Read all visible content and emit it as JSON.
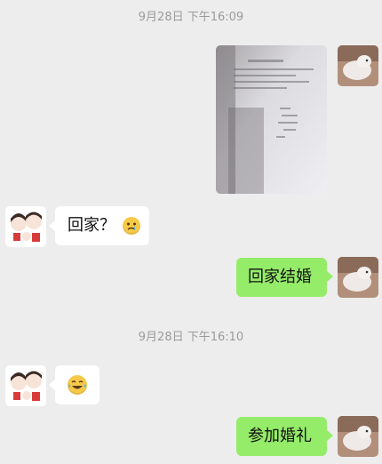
{
  "timestamps": [
    "9月28日 下午16:09",
    "9月28日 下午16:10"
  ],
  "messages": [
    {
      "side": "right",
      "type": "image",
      "image": "document-photo",
      "avatar": "cat-avatar"
    },
    {
      "side": "left",
      "type": "text",
      "text": "回家？",
      "emoji": "crying-face",
      "avatar": "couple-avatar"
    },
    {
      "side": "right",
      "type": "text",
      "text": "回家结婚",
      "avatar": "cat-avatar"
    },
    {
      "side": "left",
      "type": "emoji",
      "emoji": "laughing-crying-face",
      "avatar": "couple-avatar"
    },
    {
      "side": "right",
      "type": "text",
      "text": "参加婚礼",
      "avatar": "cat-avatar"
    }
  ],
  "colors": {
    "background": "#ededed",
    "right_bubble": "#95ec69",
    "left_bubble": "#ffffff",
    "timestamp_text": "#9b9b9b"
  }
}
